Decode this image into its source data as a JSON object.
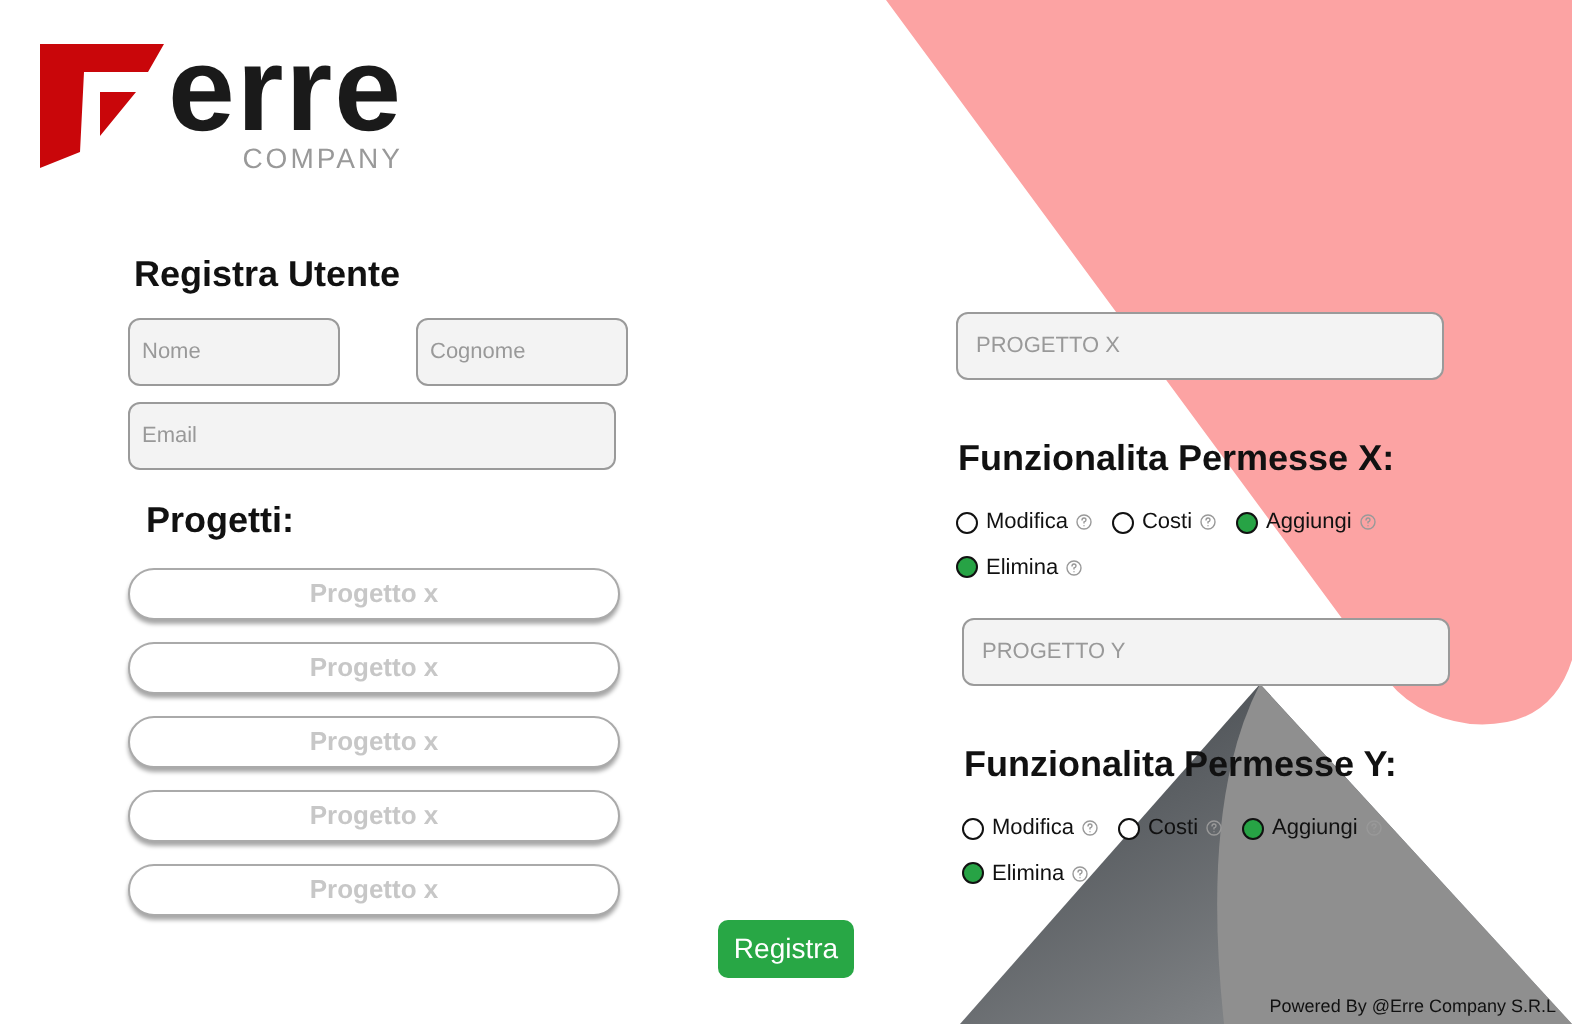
{
  "logo": {
    "wordmark": "erre",
    "subtitle": "COMPANY"
  },
  "register": {
    "title": "Registra Utente",
    "fields": [
      {
        "placeholder": "Nome"
      },
      {
        "placeholder": "Cognome"
      },
      {
        "placeholder": "Email"
      }
    ]
  },
  "projects": {
    "title": "Progetti:",
    "items": [
      "Progetto x",
      "Progetto x",
      "Progetto x",
      "Progetto x",
      "Progetto x"
    ]
  },
  "submit": "Registra",
  "permission_groups": [
    {
      "placeholder": "PROGETTO X",
      "title": "Funzionalita Permesse X:",
      "options": [
        {
          "label": "Modifica",
          "checked": false
        },
        {
          "label": "Costi",
          "checked": false
        },
        {
          "label": "Aggiungi",
          "checked": true
        },
        {
          "label": "Elimina",
          "checked": true
        }
      ]
    },
    {
      "placeholder": "PROGETTO Y",
      "title": "Funzionalita Permesse Y:",
      "options": [
        {
          "label": "Modifica",
          "checked": false
        },
        {
          "label": "Costi",
          "checked": false
        },
        {
          "label": "Aggiungi",
          "checked": true
        },
        {
          "label": "Elimina",
          "checked": true
        }
      ]
    }
  ],
  "footer": "Powered By @Erre Company S.R.L"
}
